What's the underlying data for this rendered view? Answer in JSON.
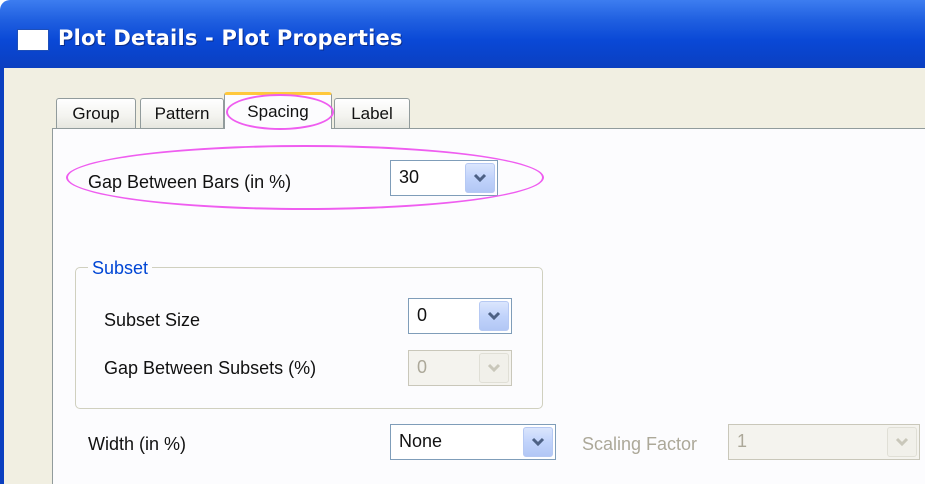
{
  "window": {
    "title": "Plot Details - Plot Properties"
  },
  "tabs": [
    {
      "label": "Group",
      "selected": false
    },
    {
      "label": "Pattern",
      "selected": false
    },
    {
      "label": "Spacing",
      "selected": true
    },
    {
      "label": "Label",
      "selected": false
    }
  ],
  "spacing": {
    "gap_between_bars": {
      "label": "Gap Between Bars (in %)",
      "value": "30"
    },
    "subset": {
      "title": "Subset",
      "subset_size": {
        "label": "Subset Size",
        "value": "0"
      },
      "gap_between_subsets": {
        "label": "Gap Between Subsets (%)",
        "value": "0",
        "disabled": true
      }
    },
    "width": {
      "label": "Width (in %)",
      "value": "None"
    },
    "scaling_factor": {
      "label": "Scaling Factor",
      "value": "1",
      "disabled": true
    }
  },
  "colors": {
    "titlebar": "#0a48d6",
    "highlight": "#ef5df0",
    "tab_selected_accent": "#ffc83c",
    "groupbox_title": "#0046d5"
  },
  "icons": {
    "window": "window-icon",
    "dropdown": "chevron-down-icon"
  }
}
